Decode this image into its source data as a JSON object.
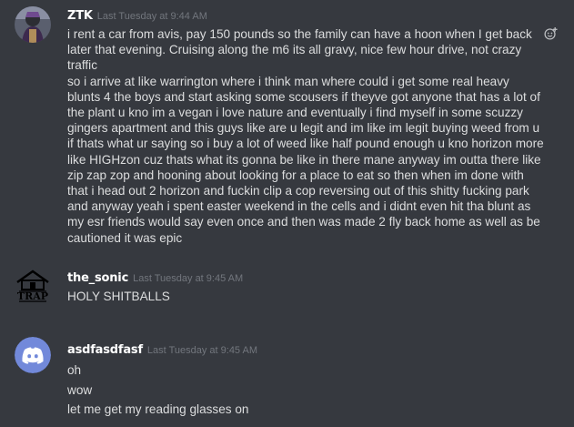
{
  "messages": [
    {
      "username": "ZTK",
      "timestamp": "Last Tuesday at 9:44 AM",
      "avatar_icon": "user-avatar-photo",
      "lines": [
        "i rent a car from avis, pay 150 pounds so the family can have a hoon when I get back",
        "later that evening. Cruising along the m6 its all gravy, nice few hour drive, not crazy",
        "traffic",
        "so i arrive at like warrington where i think man where could i get some real heavy",
        "blunts 4 the boys and start asking some scousers if theyve got anyone that has a lot of",
        "the plant u kno im a vegan i love nature and eventually i find myself in some scuzzy",
        "gingers apartment and this guys like are u legit and im like im legit buying weed from u",
        "if thats what ur saying so i buy a lot of weed like half pound enough u kno horizon more",
        "like HIGHzon cuz thats what its gonna be like in there mane anyway im outta there like",
        "zip zap zop and hooning about looking for a place to eat so then when im done with",
        "that i head out 2 horizon and fuckin clip a cop reversing out of this shitty fucking park",
        "and anyway yeah i spent easter weekend in the cells and i didnt even hit tha blunt as",
        "my esr friends would say even once and then was made 2 fly back home as well as be",
        "cautioned it was epic"
      ]
    },
    {
      "username": "the_sonic",
      "timestamp": "Last Tuesday at 9:45 AM",
      "avatar_icon": "trap-house-avatar",
      "avatar_text": "TRAP",
      "lines": [
        "HOLY SHITBALLS"
      ]
    },
    {
      "username": "asdfasdfasf",
      "timestamp": "Last Tuesday at 9:45 AM",
      "avatar_icon": "discord-logo-avatar",
      "lines": [
        "oh",
        "wow",
        "let me get my reading glasses on"
      ]
    }
  ],
  "colors": {
    "background": "#36393f",
    "text": "#dcddde",
    "username": "#ffffff",
    "timestamp": "#72767d",
    "discord_blurple": "#7289da"
  }
}
